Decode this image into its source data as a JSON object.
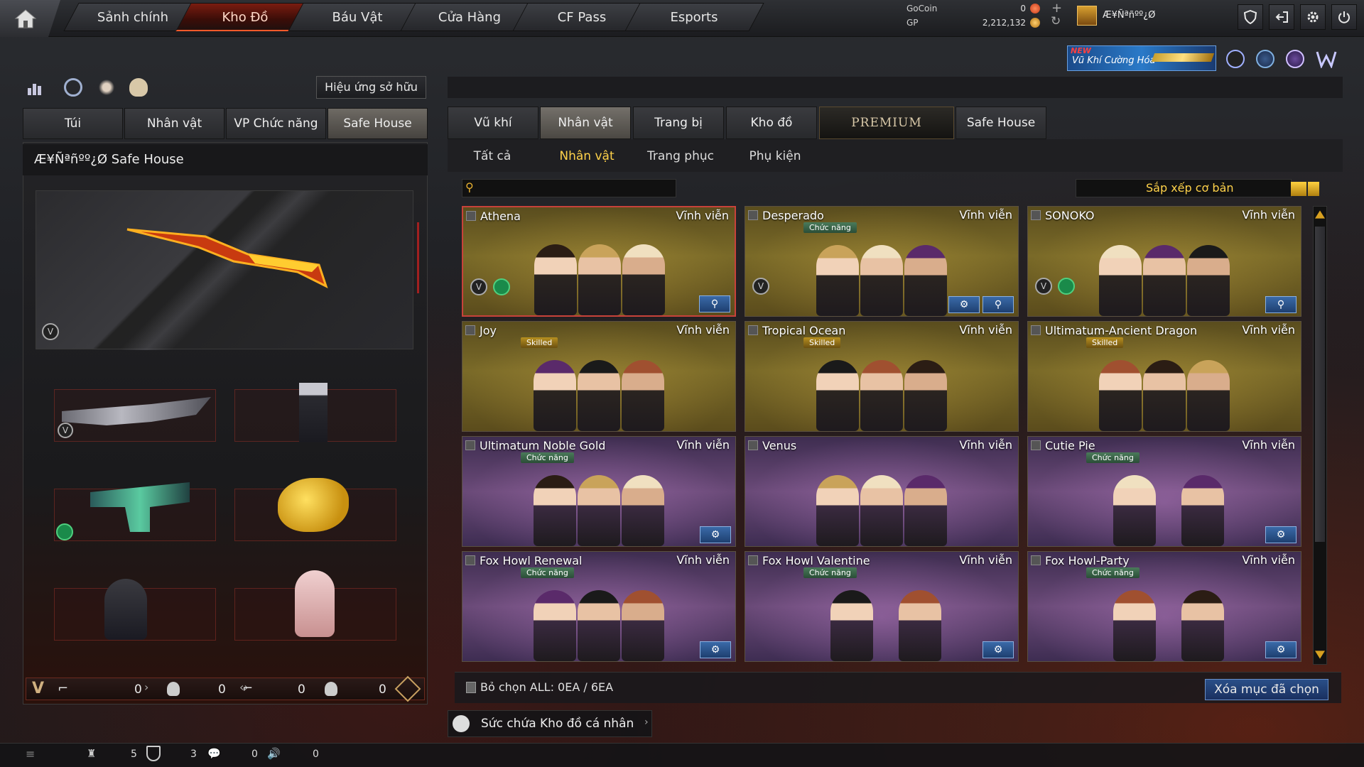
{
  "nav": {
    "tabs": [
      "Sảnh chính",
      "Kho Đồ",
      "Báu Vật",
      "Cửa Hàng",
      "CF Pass",
      "Esports"
    ],
    "active": "Kho Đồ"
  },
  "currency": {
    "gocoin_label": "GoCoin",
    "gocoin_value": "0",
    "gp_label": "GP",
    "gp_value": "2,212,132"
  },
  "player": {
    "name": "Æ¥Ñªñºº¿Ø"
  },
  "promo": {
    "new_label": "NEW",
    "text": "Vũ Khí Cường Hóa"
  },
  "left": {
    "effect_button": "Hiệu ứng sở hữu",
    "tabs": [
      "Túi",
      "Nhân vật",
      "VP Chức năng",
      "Safe House"
    ],
    "active_tab": "Safe House",
    "title": "Æ¥Ñªñºº¿Ø Safe House",
    "stats": [
      "0",
      "0",
      "0",
      "0"
    ]
  },
  "right": {
    "tabs": [
      "Vũ khí",
      "Nhân vật",
      "Trang bị",
      "Kho đồ",
      "PREMIUM",
      "Safe House"
    ],
    "active_tab": "Nhân vật",
    "subtabs": [
      "Tất cả",
      "Nhân vật",
      "Trang phục",
      "Phụ kiện"
    ],
    "active_subtab": "Nhân vật",
    "search_placeholder": "",
    "sort_label": "Sắp xếp cơ bản",
    "items": [
      {
        "name": "Athena",
        "perm": "Vĩnh viễn",
        "theme": "gold",
        "badge": "",
        "selected": true
      },
      {
        "name": "Desperado",
        "perm": "Vĩnh viễn",
        "theme": "gold",
        "badge": "Chức năng",
        "selected": false
      },
      {
        "name": "SONOKO",
        "perm": "Vĩnh viễn",
        "theme": "gold",
        "badge": "",
        "selected": false
      },
      {
        "name": "Joy",
        "perm": "Vĩnh viễn",
        "theme": "gold",
        "badge": "Skilled",
        "selected": false
      },
      {
        "name": "Tropical Ocean",
        "perm": "Vĩnh viễn",
        "theme": "gold",
        "badge": "Skilled",
        "selected": false
      },
      {
        "name": "Ultimatum-Ancient Dragon",
        "perm": "Vĩnh viễn",
        "theme": "gold",
        "badge": "Skilled",
        "selected": false
      },
      {
        "name": "Ultimatum Noble Gold",
        "perm": "Vĩnh viễn",
        "theme": "purple",
        "badge": "Chức năng",
        "selected": false
      },
      {
        "name": "Venus",
        "perm": "Vĩnh viễn",
        "theme": "purple",
        "badge": "",
        "selected": false
      },
      {
        "name": "Cutie Pie",
        "perm": "Vĩnh viễn",
        "theme": "purple",
        "badge": "Chức năng",
        "selected": false
      },
      {
        "name": "Fox Howl Renewal",
        "perm": "Vĩnh viễn",
        "theme": "purple",
        "badge": "Chức năng",
        "selected": false
      },
      {
        "name": "Fox Howl Valentine",
        "perm": "Vĩnh viễn",
        "theme": "purple",
        "badge": "Chức năng",
        "selected": false
      },
      {
        "name": "Fox Howl-Party",
        "perm": "Vĩnh viễn",
        "theme": "purple",
        "badge": "Chức năng",
        "selected": false
      }
    ],
    "deselect_label": "Bỏ chọn ALL: 0EA / 6EA",
    "delete_button": "Xóa mục đã chọn",
    "capacity_label": "Sức chứa Kho đồ cá nhân"
  },
  "bottom": {
    "counts": [
      "5",
      "3",
      "0",
      "0"
    ]
  },
  "colors": {
    "accent": "#c8423a",
    "gold": "#ffd24a",
    "button_blue": "#2a4f88"
  }
}
